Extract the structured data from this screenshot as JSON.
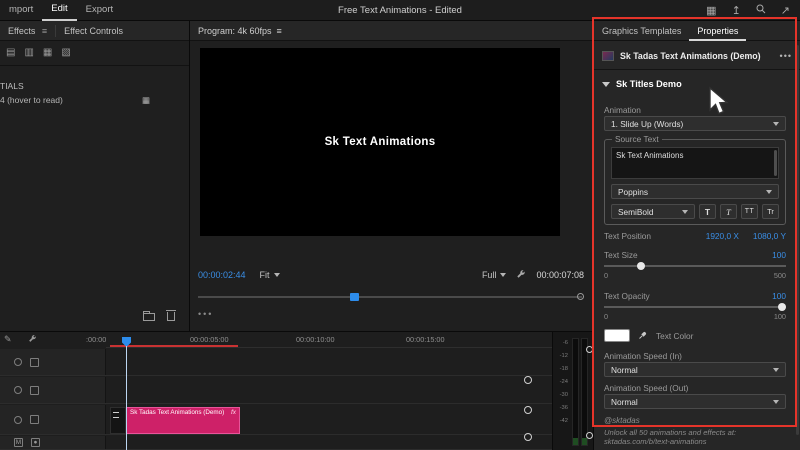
{
  "menubar": {
    "items": [
      "mport",
      "Edit",
      "Export"
    ],
    "title": "Free Text Animations - Edited"
  },
  "left_panel": {
    "tab_effects": "Effects",
    "tab_effect_controls": "Effect Controls",
    "bin_label": "TIALS",
    "item_label": "4 (hover to read)"
  },
  "program": {
    "header": "Program: 4k 60fps",
    "video_text": "Sk Text Animations",
    "current_time": "00:00:02:44",
    "fit_label": "Fit",
    "quality_label": "Full",
    "duration": "00:00:07:08",
    "dots": "•••"
  },
  "properties": {
    "tab_templates": "Graphics Templates",
    "tab_properties": "Properties",
    "menu_dots": "•••",
    "clip_name": "Sk Tadas Text Animations (Demo)",
    "section_title": "Sk Titles Demo",
    "animation": {
      "label": "Animation",
      "value": "1. Slide Up (Words)"
    },
    "source_text": {
      "group_label": "Source Text",
      "value": "Sk Text Animations",
      "font": "Poppins",
      "style": "SemiBold",
      "style_buttons": [
        "T",
        "T",
        "TT",
        "Tr"
      ]
    },
    "position": {
      "label": "Text Position",
      "x": "1920,0 X",
      "y": "1080,0 Y"
    },
    "size": {
      "label": "Text Size",
      "value": "100",
      "min": "0",
      "max": "500"
    },
    "opacity": {
      "label": "Text Opacity",
      "value": "100",
      "min": "0",
      "max": "100"
    },
    "color": {
      "label": "Text Color"
    },
    "speed_in": {
      "label": "Animation Speed (In)",
      "value": "Normal"
    },
    "speed_out": {
      "label": "Animation Speed (Out)",
      "value": "Normal"
    },
    "credit": "@sktadas",
    "promo": "Unlock all 50 animations and effects at: sktadas.com/b/text-animations"
  },
  "timeline": {
    "ruler": [
      ":00:00",
      "00:00:05:00",
      "00:00:10:00",
      "00:00:15:00"
    ],
    "clip_label": "Sk Tadas Text Animations (Demo)",
    "clip_fx": "fx"
  },
  "meters": {
    "scale": [
      "-6",
      "-12",
      "-18",
      "-24",
      "-30",
      "-36",
      "-42"
    ]
  }
}
